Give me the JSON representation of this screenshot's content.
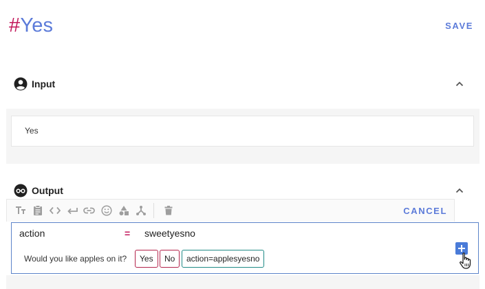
{
  "header": {
    "title_hash": "#",
    "title_name": "Yes",
    "save_label": "SAVE"
  },
  "input_section": {
    "label": "Input",
    "icon": "account-circle-icon",
    "value": "Yes",
    "collapsed": false
  },
  "output_section": {
    "label": "Output",
    "icon": "bot-icon",
    "toolbar": {
      "icons": [
        "text-format-icon",
        "clipboard-icon",
        "code-icon",
        "return-icon",
        "link-icon",
        "emoji-icon",
        "shapes-icon",
        "fork-icon",
        "trash-icon"
      ],
      "cancel_label": "CANCEL"
    },
    "editor": {
      "key": "action",
      "operator": "=",
      "value": "sweetyesno",
      "prompt": "Would you like apples on it?",
      "chips": [
        "Yes",
        "No",
        "action=applesyesno"
      ],
      "add_icon": "plus-icon"
    }
  },
  "colors": {
    "accent": "#5c7bd9",
    "hash": "#c2185b",
    "chip_button": "#b3224a",
    "chip_action": "#1f8a86",
    "editor_border": "#5b83c9",
    "add_button": "#4a7bd8"
  }
}
